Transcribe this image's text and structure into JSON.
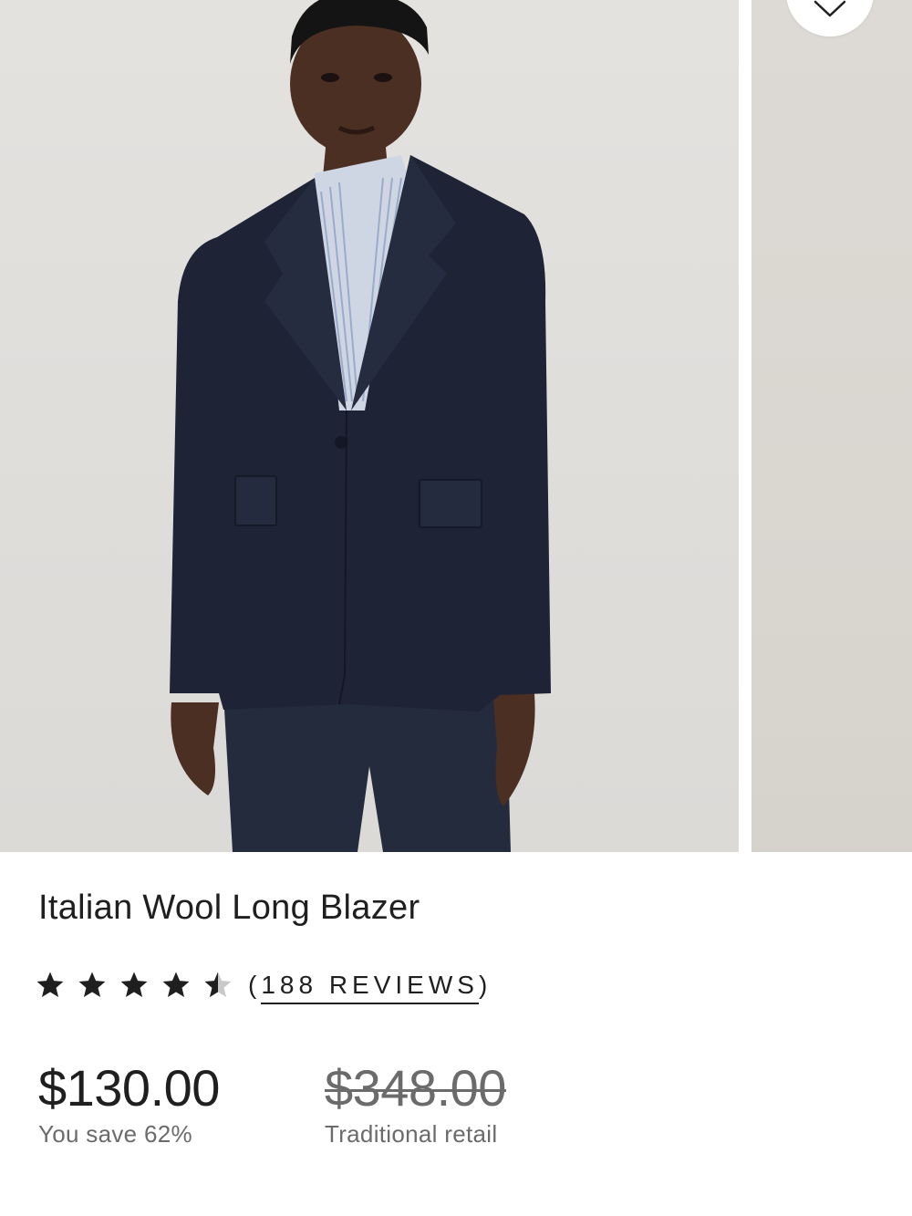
{
  "product": {
    "title": "Italian Wool Long Blazer",
    "rating": 4.5,
    "rating_max": 5,
    "reviews_open": "(",
    "reviews_text": "188 REVIEWS",
    "reviews_close": ")",
    "price": "$130.00",
    "savings": "You save 62%",
    "retail_price": "$348.00",
    "retail_label": "Traditional retail"
  },
  "icons": {
    "wishlist": "heart-icon",
    "rating": "star-icon"
  },
  "colors": {
    "text": "#1f1f1f",
    "muted": "#6b6b6b",
    "blazer": "#1e2436",
    "photo_bg": "#e2e0dd"
  }
}
